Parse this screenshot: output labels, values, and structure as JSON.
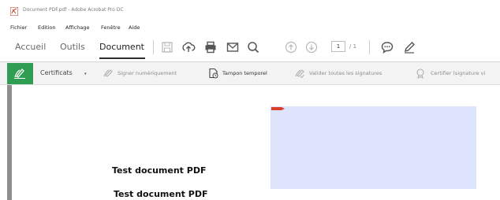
{
  "window": {
    "title": "Document PDF.pdf - Adobe Acrobat Pro DC"
  },
  "menu": {
    "items": [
      "Fichier",
      "Edition",
      "Affichage",
      "Fenêtre",
      "Aide"
    ]
  },
  "tabs": {
    "items": [
      "Accueil",
      "Outils",
      "Document"
    ],
    "active": "Document"
  },
  "toolbar": {
    "icons": [
      "save-icon",
      "upload-icon",
      "print-icon",
      "email-icon",
      "search-icon",
      "page-up-icon",
      "page-down-icon",
      "comment-icon",
      "pen-icon"
    ],
    "page_current": "1",
    "page_total": "/ 1"
  },
  "certificates": {
    "label": "Certificats",
    "caret": "▾",
    "items": [
      {
        "label": "Signer numériquement",
        "icon": "sign-pen-icon"
      },
      {
        "label": "Tampon temporel",
        "icon": "timestamp-icon"
      },
      {
        "label": "Valider toutes les signatures",
        "icon": "validate-signatures-icon"
      },
      {
        "label": "Certifier (signature vi",
        "icon": "certify-icon"
      }
    ]
  },
  "document": {
    "lines": [
      "Test document PDF",
      "Test document PDF"
    ]
  },
  "colors": {
    "accent_green": "#2f9e54",
    "highlight_blue": "#dde4fb",
    "marker_red": "#d9402b"
  }
}
